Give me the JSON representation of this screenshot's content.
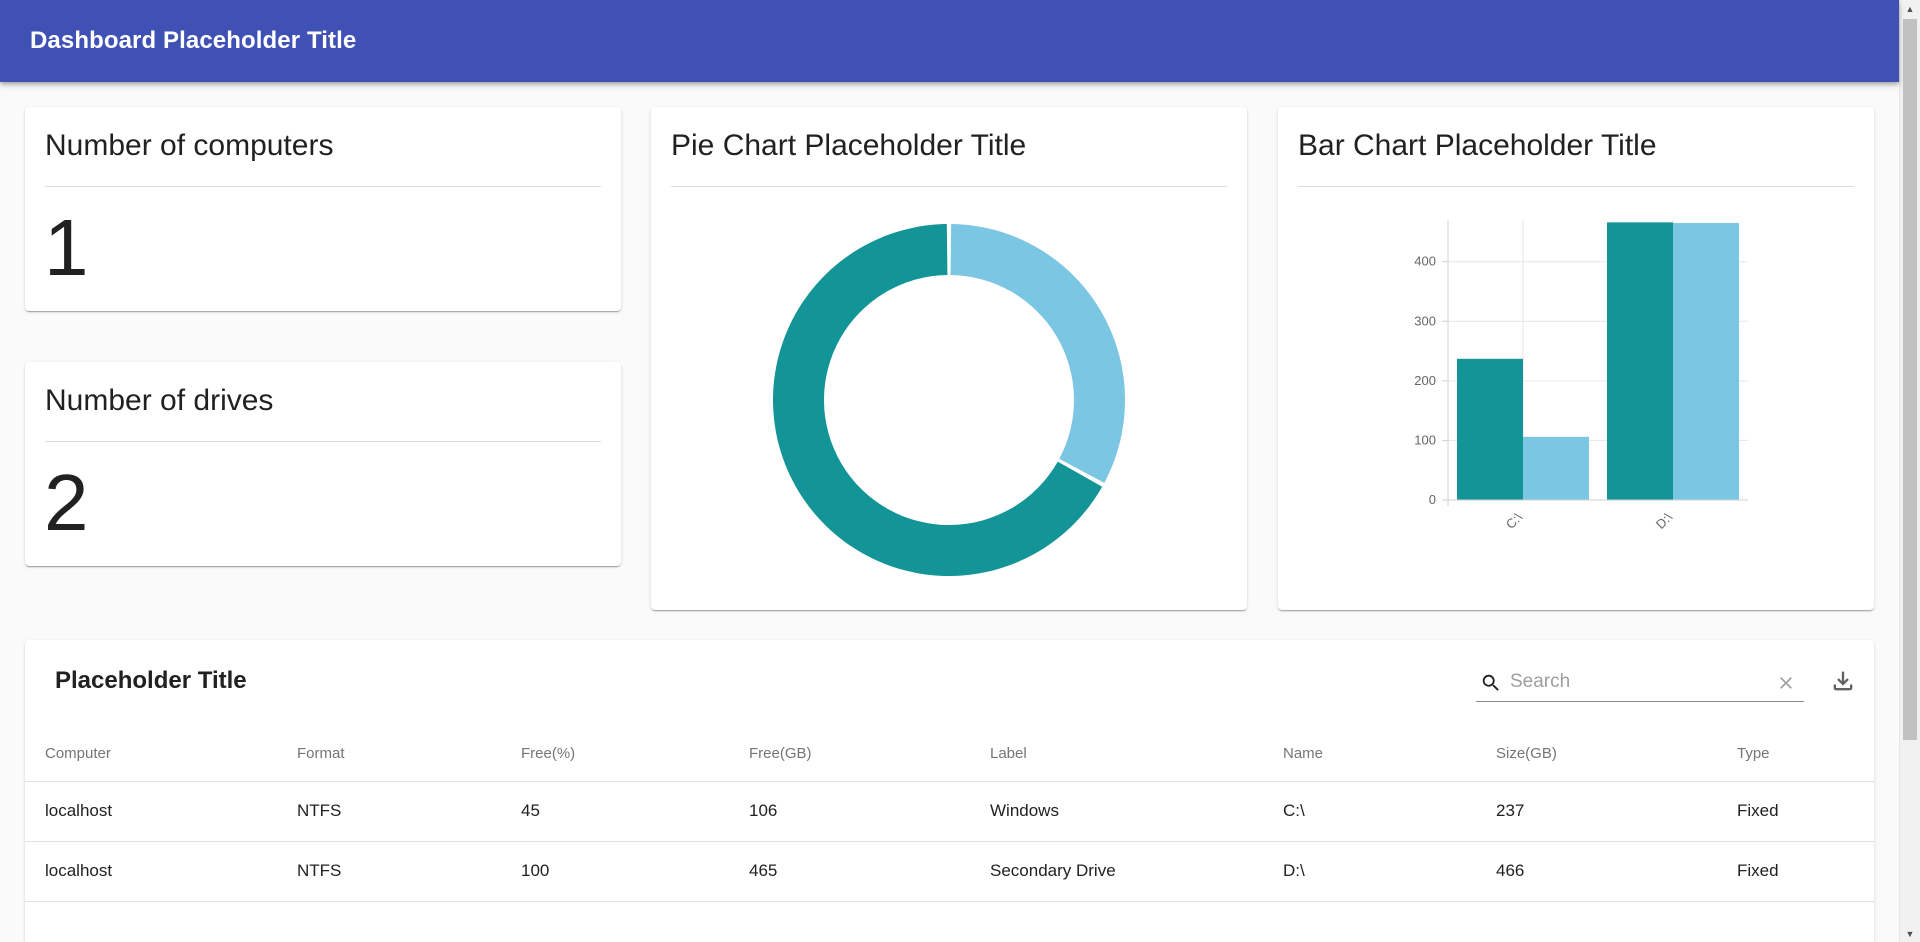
{
  "appbar": {
    "title": "Dashboard Placeholder Title"
  },
  "cards": {
    "computers": {
      "title": "Number of computers",
      "value": "1"
    },
    "drives": {
      "title": "Number of drives",
      "value": "2"
    },
    "pie": {
      "title": "Pie Chart Placeholder Title"
    },
    "bar": {
      "title": "Bar Chart Placeholder Title"
    }
  },
  "colors": {
    "appbar": "#3f51b5",
    "series_dark": "#139496",
    "series_light": "#7bc6e3"
  },
  "chart_data": [
    {
      "type": "pie",
      "title": "Pie Chart Placeholder Title",
      "donut": true,
      "slices": [
        {
          "value": 0.33,
          "color": "#7bc6e3"
        },
        {
          "value": 0.67,
          "color": "#139496"
        }
      ]
    },
    {
      "type": "bar",
      "title": "Bar Chart Placeholder Title",
      "categories": [
        "C:\\",
        "D:\\"
      ],
      "series": [
        {
          "values": [
            237,
            466
          ],
          "color": "#139496"
        },
        {
          "values": [
            106,
            465
          ],
          "color": "#7bc6e3"
        }
      ],
      "ylim": [
        0,
        470
      ],
      "yticks": [
        "0",
        "100",
        "200",
        "300",
        "400"
      ],
      "grid": true,
      "legend": "none"
    }
  ],
  "table": {
    "title": "Placeholder Title",
    "search": {
      "placeholder": "Search",
      "value": ""
    },
    "icons": {
      "search": "search-icon",
      "clear": "close-icon",
      "download": "download-icon"
    },
    "columns": [
      "Computer",
      "Format",
      "Free(%)",
      "Free(GB)",
      "Label",
      "Name",
      "Size(GB)",
      "Type"
    ],
    "rows": [
      [
        "localhost",
        "NTFS",
        "45",
        "106",
        "Windows",
        "C:\\",
        "237",
        "Fixed"
      ],
      [
        "localhost",
        "NTFS",
        "100",
        "465",
        "Secondary Drive",
        "D:\\",
        "466",
        "Fixed"
      ]
    ]
  }
}
